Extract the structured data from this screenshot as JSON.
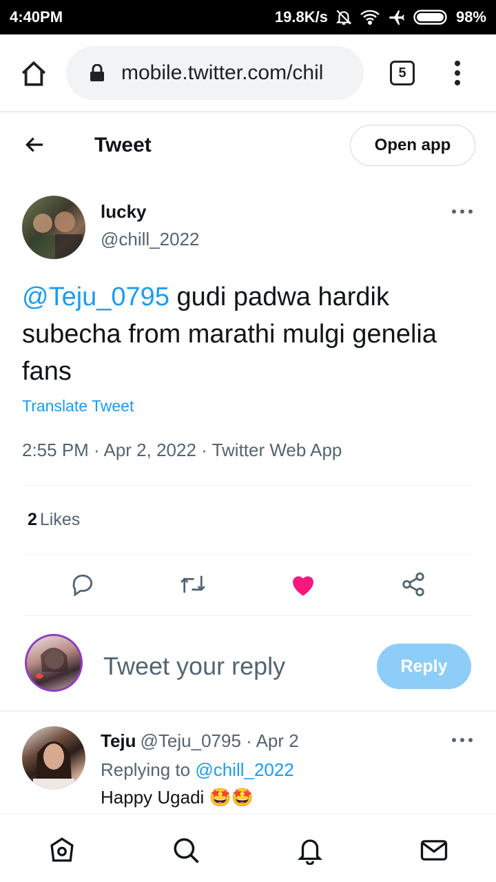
{
  "status_bar": {
    "time": "4:40PM",
    "net_speed": "19.8K/s",
    "battery": "98%"
  },
  "browser": {
    "url": "mobile.twitter.com/chil",
    "tab_count": "5"
  },
  "header": {
    "title": "Tweet",
    "open_app_label": "Open app"
  },
  "tweet": {
    "author_name": "lucky",
    "author_handle": "@chill_2022",
    "mention": "@Teju_0795",
    "text": " gudi padwa hardik subecha from marathi mulgi genelia fans",
    "translate_label": "Translate Tweet",
    "meta": "2:55 PM · Apr 2, 2022 · Twitter Web App",
    "like_count": "2",
    "likes_label": "Likes"
  },
  "compose": {
    "placeholder": "Tweet your reply",
    "reply_button_label": "Reply"
  },
  "reply": {
    "name": "Teju",
    "handle_date": "@Teju_0795 · Apr 2",
    "replying_prefix": "Replying to ",
    "replying_to": "@chill_2022",
    "text": "Happy Ugadi ",
    "emoji": "🤩🤩"
  },
  "colors": {
    "accent": "#1d9bf0",
    "like": "#f91880",
    "reply_button": "#8ecdf8",
    "secondary_text": "#536471"
  },
  "icons": [
    "home-icon",
    "lock-icon",
    "back-arrow-icon",
    "more-icon",
    "reply-icon",
    "retweet-icon",
    "heart-icon",
    "share-icon",
    "search-icon",
    "bell-icon",
    "mail-icon"
  ]
}
